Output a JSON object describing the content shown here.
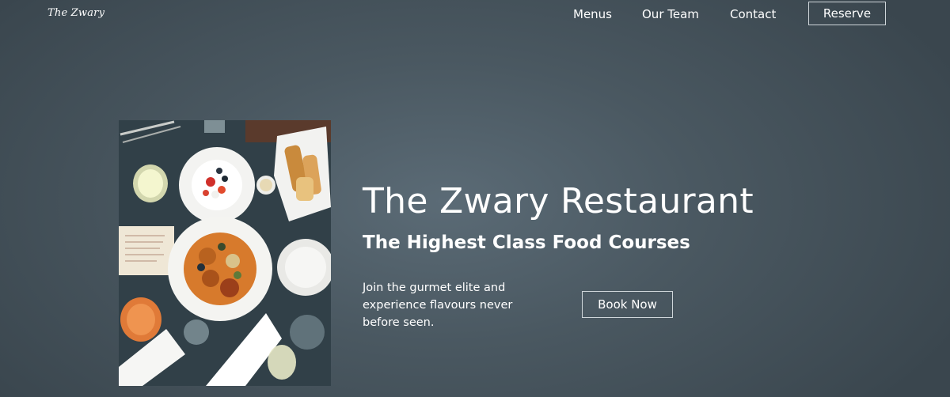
{
  "header": {
    "logo_text": "The Zwary",
    "nav_items": [
      {
        "label": "Menus"
      },
      {
        "label": "Our Team"
      },
      {
        "label": "Contact"
      }
    ],
    "reserve_label": "Reserve"
  },
  "hero": {
    "title": "The Zwary Restaurant",
    "subtitle": "The Highest Class Food Courses",
    "description": "Join the gurmet elite and experience flavours never before seen.",
    "cta_label": "Book Now",
    "image": {
      "icon": "restaurant-table-photo"
    }
  },
  "colors": {
    "background": "#4a5861",
    "text": "#ffffff",
    "button_border": "#cfd6da"
  }
}
